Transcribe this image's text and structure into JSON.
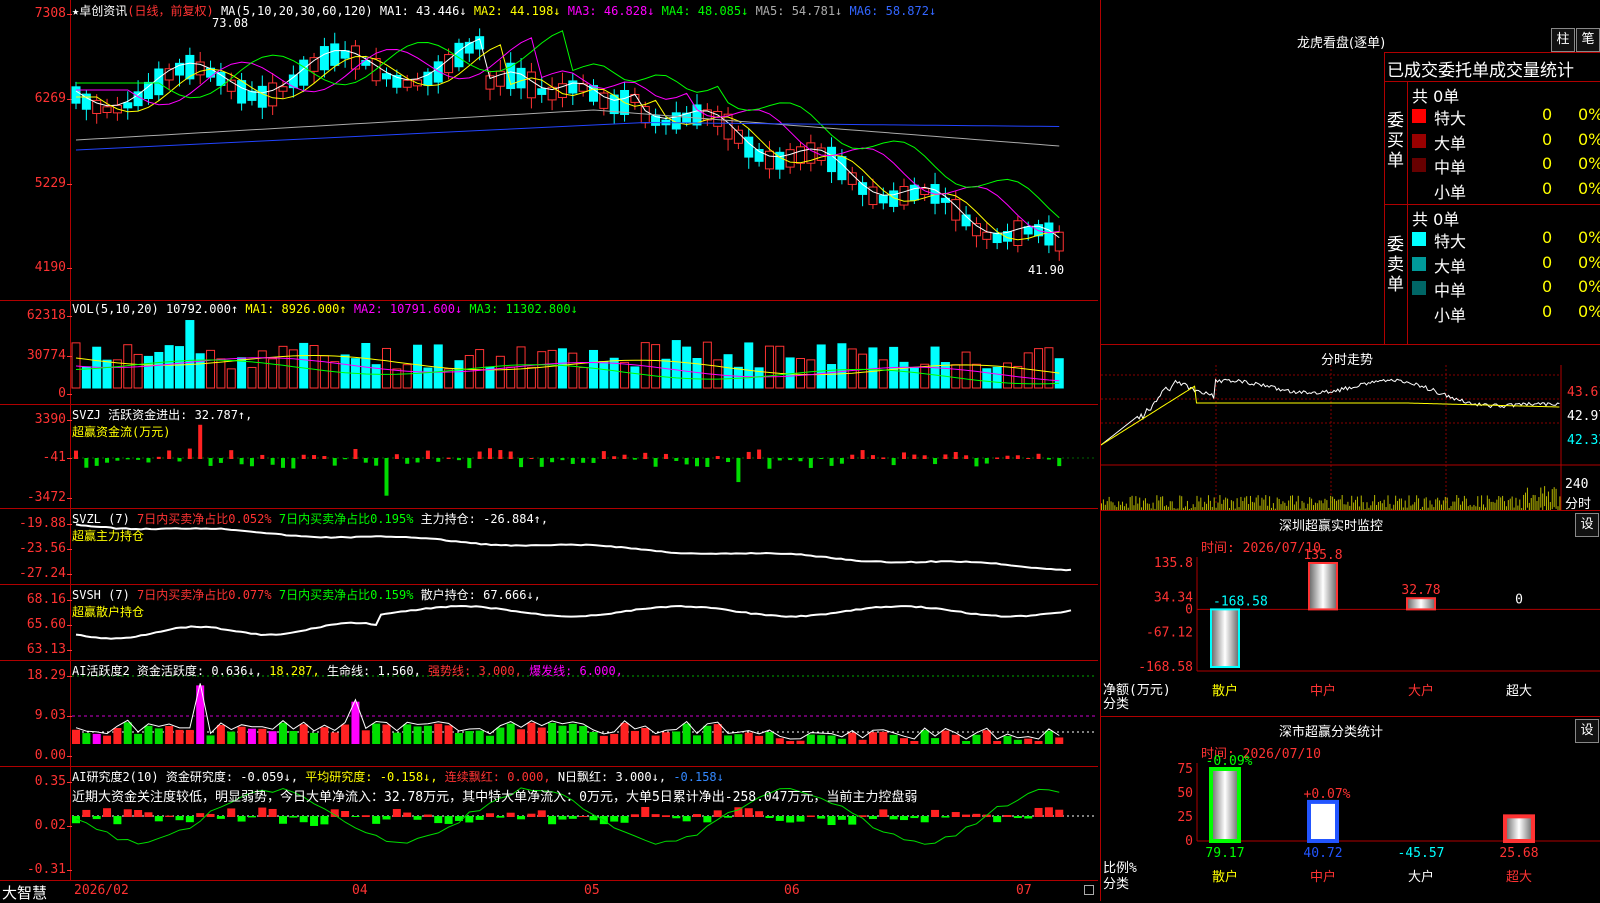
{
  "title": {
    "stock": "卓创资讯",
    "period": "(日线，前复权)"
  },
  "main": {
    "ma_label": "MA(5,10,20,30,60,120)",
    "ma": [
      {
        "label": "MA1: 43.446↓",
        "color": "#ffffff"
      },
      {
        "label": "MA2: 44.198↓",
        "color": "#ffff00"
      },
      {
        "label": "MA3: 46.828↓",
        "color": "#ff00ff"
      },
      {
        "label": "MA4: 48.085↓",
        "color": "#00ff00"
      },
      {
        "label": "MA5: 54.781↓",
        "color": "#aaaaaa"
      },
      {
        "label": "MA6: 58.872↓",
        "color": "#3366ff"
      }
    ],
    "yticks": [
      "7308",
      "6269",
      "5229",
      "4190"
    ],
    "high_label": "73.08",
    "low_label": "41.90"
  },
  "vol": {
    "head": "VOL(5,10,20)",
    "value": "10792.000↑",
    "ma1": "MA1: 8926.000↑",
    "ma2": "MA2: 10791.600↓",
    "ma3": "MA3: 11302.800↓",
    "yticks": [
      "62318",
      "30774",
      "0"
    ]
  },
  "svzj": {
    "head": "SVZJ  活跃资金进出: 32.787↑,",
    "sub": "超赢资金流(万元)",
    "yticks": [
      "3390",
      "-41",
      "-3472"
    ]
  },
  "svzl": {
    "head": "SVZL (7)",
    "a": "7日内买卖净占比0.052%",
    "b": "7日内买卖净占比0.195%",
    "c": "主力持仓: -26.884↑,",
    "sub": "超赢主力持仓",
    "yticks": [
      "-19.88",
      "-23.56",
      "-27.24"
    ]
  },
  "svsh": {
    "head": "SVSH (7)",
    "a": "7日内买卖净占比0.077%",
    "b": "7日内买卖净占比0.159%",
    "c": "散户持仓: 67.666↓,",
    "sub": "超赢散户持仓",
    "yticks": [
      "68.16",
      "65.60",
      "63.13"
    ]
  },
  "ai1": {
    "head": "AI活跃度2",
    "a": "资金活跃度: 0.636↓,",
    "b": "18.287,",
    "c": "生命线: 1.560,",
    "d": "强势线: 3.000,",
    "e": "爆发线: 6.000,",
    "yticks": [
      "18.29",
      "9.03",
      "0.00"
    ]
  },
  "ai2": {
    "head": "AI研究度2(10)",
    "a": "资金研究度: -0.059↓,",
    "b": "平均研究度: -0.158↓,",
    "c": "连续飘红: 0.000,",
    "d": "N日飘红: 3.000↓,",
    "e": "-0.158↓",
    "note": "近期大资金关注度较低，明显弱势，今日大单净流入：32.78万元，其中特大单净流入：0万元，大单5日累计净出-258.047万元，当前主力控盘弱",
    "yticks": [
      "0.35",
      "0.02",
      "-0.31"
    ]
  },
  "xaxis": {
    "brand": "大智慧",
    "labels": [
      "2026/02",
      "04",
      "05",
      "06",
      "07"
    ]
  },
  "dragon": {
    "title": "龙虎看盘(逐单)",
    "btn1": "柱",
    "btn2": "笔",
    "subtitle": "已成交委托单成交量统计",
    "buy": {
      "label": "委买单",
      "total": "共 0单",
      "rows": [
        {
          "name": "特大",
          "val": "0",
          "pct": "0%",
          "color": "#ff0000"
        },
        {
          "name": "大单",
          "val": "0",
          "pct": "0%",
          "color": "#990000"
        },
        {
          "name": "中单",
          "val": "0",
          "pct": "0%",
          "color": "#660000"
        },
        {
          "name": "小单",
          "val": "0",
          "pct": "0%",
          "color": "#000000"
        }
      ]
    },
    "sell": {
      "label": "委卖单",
      "total": "共 0单",
      "rows": [
        {
          "name": "特大",
          "val": "0",
          "pct": "0%",
          "color": "#00ffff"
        },
        {
          "name": "大单",
          "val": "0",
          "pct": "0%",
          "color": "#009999"
        },
        {
          "name": "中单",
          "val": "0",
          "pct": "0%",
          "color": "#006666"
        },
        {
          "name": "小单",
          "val": "0",
          "pct": "0%",
          "color": "#000000"
        }
      ]
    }
  },
  "intraday": {
    "title": "分时走势",
    "prices": [
      "43.61",
      "42.97",
      "42.33"
    ],
    "vol_label": "240",
    "vol_unit": "分时"
  },
  "sz_monitor": {
    "title": "深圳超赢实时监控",
    "set": "设",
    "time": "时间: 2026/07/10",
    "yticks": [
      "135.8",
      "34.34",
      "0",
      "-67.12",
      "-168.58"
    ],
    "ylabel": "净额(万元)",
    "xlabel": "分类",
    "chart_data": {
      "type": "bar",
      "categories": [
        "散户",
        "中户",
        "大户",
        "超大"
      ],
      "values": [
        -168.58,
        135.8,
        32.78,
        0
      ],
      "labels": [
        "-168.58",
        "135.8",
        "32.78",
        "0"
      ],
      "ylim": [
        -168.58,
        135.8
      ]
    }
  },
  "sz_stats": {
    "title": "深市超赢分类统计",
    "set": "设",
    "time": "时间: 2026/07/10",
    "yticks": [
      "75",
      "50",
      "25",
      "0"
    ],
    "ylabel": "比例%",
    "xlabel": "分类",
    "chart_data": {
      "type": "bar",
      "categories": [
        "散户",
        "中户",
        "大户",
        "超大"
      ],
      "values": [
        79.17,
        40.72,
        -45.57,
        25.68
      ],
      "top_labels": [
        "-0.09%",
        "+0.07%",
        "",
        ""
      ],
      "labels": [
        "79.17",
        "40.72",
        "-45.57",
        "25.68"
      ],
      "ylim": [
        0,
        75
      ]
    }
  }
}
